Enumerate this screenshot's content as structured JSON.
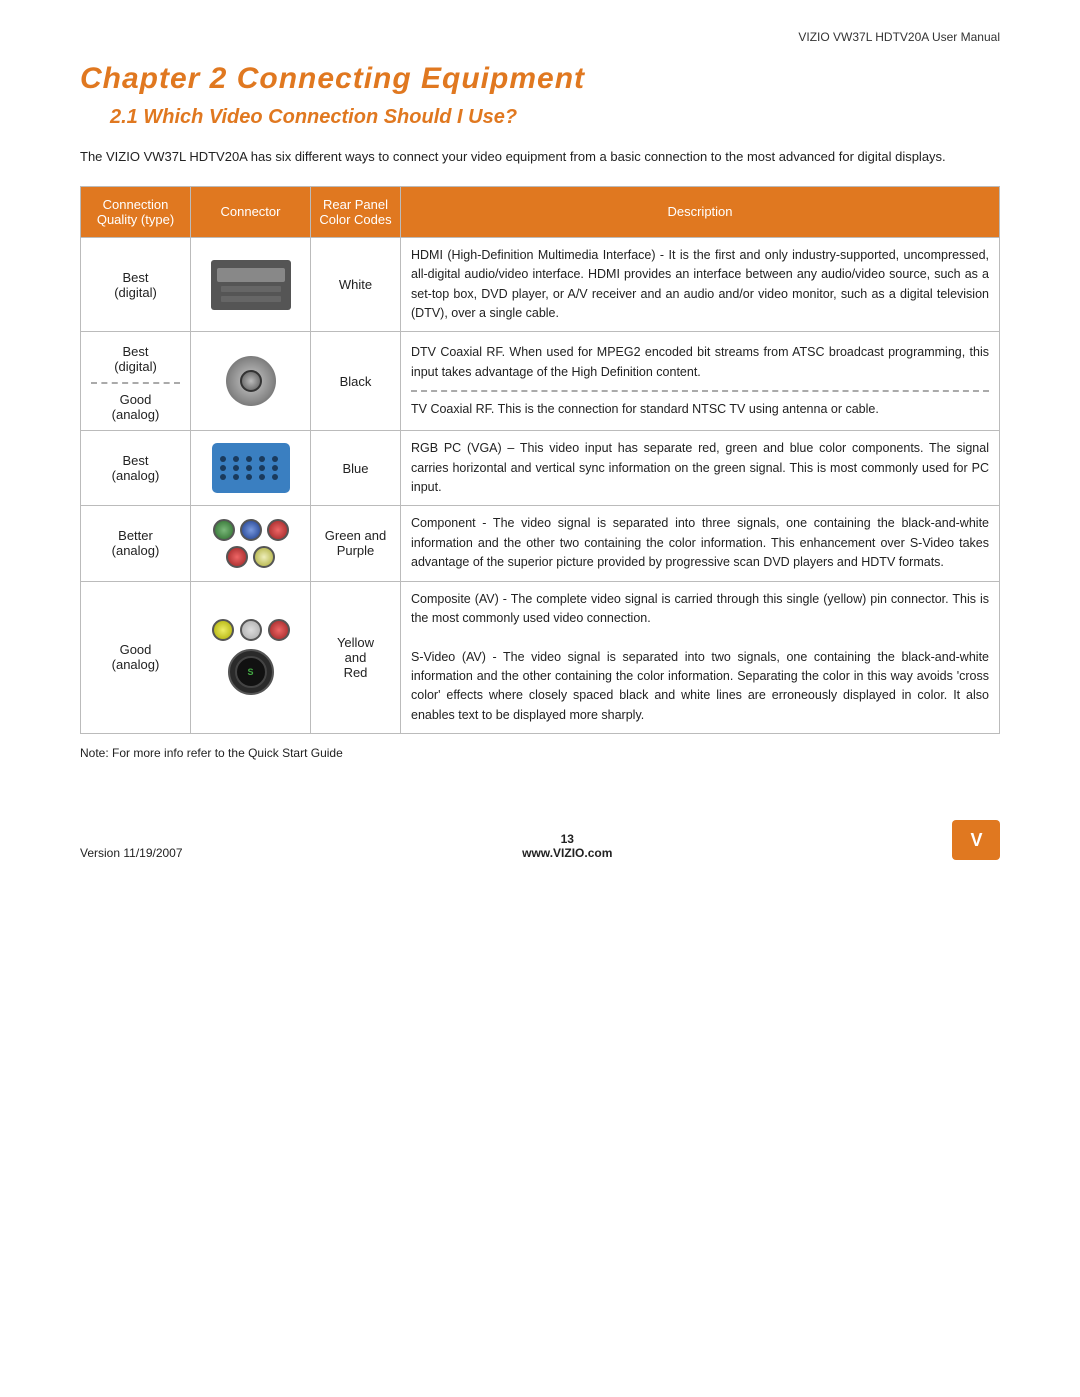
{
  "header": {
    "manual_title": "VIZIO VW37L HDTV20A User Manual"
  },
  "chapter": {
    "title": "Chapter 2  Connecting Equipment",
    "section_title": "2.1 Which Video Connection Should I Use?",
    "intro": "The VIZIO VW37L HDTV20A has six different ways to connect your video equipment from a basic connection to the most advanced for digital displays."
  },
  "table": {
    "headers": {
      "quality": "Connection Quality (type)",
      "connector": "Connector",
      "color": "Rear Panel Color Codes",
      "description": "Description"
    },
    "rows": [
      {
        "quality": "Best\n(digital)",
        "color": "White",
        "description": "HDMI (High-Definition Multimedia Interface) - It is the first and only industry-supported, uncompressed, all-digital audio/video interface. HDMI provides an interface between any audio/video source, such as a set-top box, DVD player, or A/V receiver and an audio and/or video monitor, such as a digital television (DTV), over a single cable."
      },
      {
        "quality_top": "Best\n(digital)",
        "quality_bottom": "Good\n(analog)",
        "color": "Black",
        "desc_top": "DTV Coaxial RF. When used for MPEG2 encoded bit streams from ATSC broadcast programming, this input takes advantage of the High Definition content.",
        "desc_bottom": "TV Coaxial RF. This is the connection for standard NTSC TV using antenna or cable."
      },
      {
        "quality": "Best\n(analog)",
        "color": "Blue",
        "description": "RGB PC (VGA) – This video input has separate red, green and blue color components.  The signal carries horizontal and vertical sync information on the green signal.  This is most commonly used for PC input."
      },
      {
        "quality": "Better\n(analog)",
        "color": "Green and Purple",
        "description": "Component - The video signal is separated into three signals, one containing the black-and-white information and the other two containing the color information. This enhancement over S-Video takes advantage of the superior picture provided by progressive scan DVD players and HDTV formats."
      },
      {
        "quality": "Good\n(analog)",
        "color_line1": "Yellow",
        "color_line2": "and",
        "color_line3": "Red",
        "desc_top": "Composite (AV) - The complete video signal is carried through this single (yellow) pin connector. This is the most commonly used video connection.",
        "desc_bottom": "S-Video (AV) - The video signal is separated into two signals, one containing the black-and-white information and the other containing the color information. Separating the color in this way avoids 'cross color' effects where closely spaced black and white lines are erroneously displayed in color. It also enables text to be displayed more sharply."
      }
    ]
  },
  "note": "Note:  For more info refer to the Quick Start Guide",
  "footer": {
    "version": "Version 11/19/2007",
    "page_number": "13",
    "website": "www.VIZIO.com"
  }
}
